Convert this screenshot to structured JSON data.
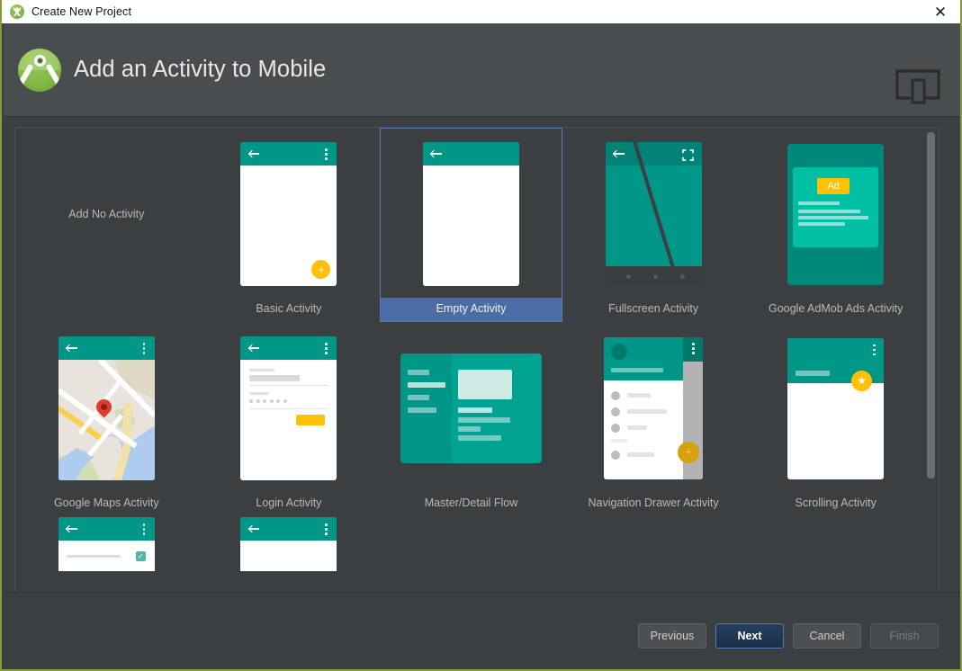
{
  "titlebar": {
    "title": "Create New Project",
    "app_icon": "android-studio-icon",
    "close_label": "✕"
  },
  "header": {
    "title": "Add an Activity to Mobile",
    "logo": "android-studio-logo",
    "device_icon": "mobile-and-tablet-icon"
  },
  "templates": [
    {
      "id": "add-no-activity",
      "label": "Add No Activity",
      "thumb": "none",
      "selected": false
    },
    {
      "id": "basic-activity",
      "label": "Basic Activity",
      "thumb": "basic",
      "selected": false
    },
    {
      "id": "empty-activity",
      "label": "Empty Activity",
      "thumb": "empty",
      "selected": true
    },
    {
      "id": "fullscreen-activity",
      "label": "Fullscreen Activity",
      "thumb": "fullscreen",
      "selected": false
    },
    {
      "id": "admob-ads-activity",
      "label": "Google AdMob Ads Activity",
      "thumb": "admob",
      "selected": false
    },
    {
      "id": "google-maps-activity",
      "label": "Google Maps Activity",
      "thumb": "maps",
      "selected": false
    },
    {
      "id": "login-activity",
      "label": "Login Activity",
      "thumb": "login",
      "selected": false
    },
    {
      "id": "master-detail-flow",
      "label": "Master/Detail Flow",
      "thumb": "masterdetail",
      "selected": false
    },
    {
      "id": "navigation-drawer",
      "label": "Navigation Drawer Activity",
      "thumb": "navdrawer",
      "selected": false
    },
    {
      "id": "scrolling-activity",
      "label": "Scrolling Activity",
      "thumb": "scrolling",
      "selected": false
    },
    {
      "id": "settings-activity",
      "label": "",
      "thumb": "partial-a",
      "selected": false
    },
    {
      "id": "tabbed-activity",
      "label": "",
      "thumb": "partial-b",
      "selected": false
    }
  ],
  "thumb_text": {
    "ad_badge": "Ad"
  },
  "footer": {
    "previous": "Previous",
    "next": "Next",
    "cancel": "Cancel",
    "finish": "Finish"
  },
  "colors": {
    "window_bg": "#3c3f41",
    "header_bg": "#4a4d4f",
    "accent_teal": "#009688",
    "accent_amber": "#ffc107",
    "selection_blue": "#4a6da7",
    "selection_border": "#5a78b5",
    "label_text": "#b9b9b9",
    "window_border": "#8a9a3c"
  }
}
